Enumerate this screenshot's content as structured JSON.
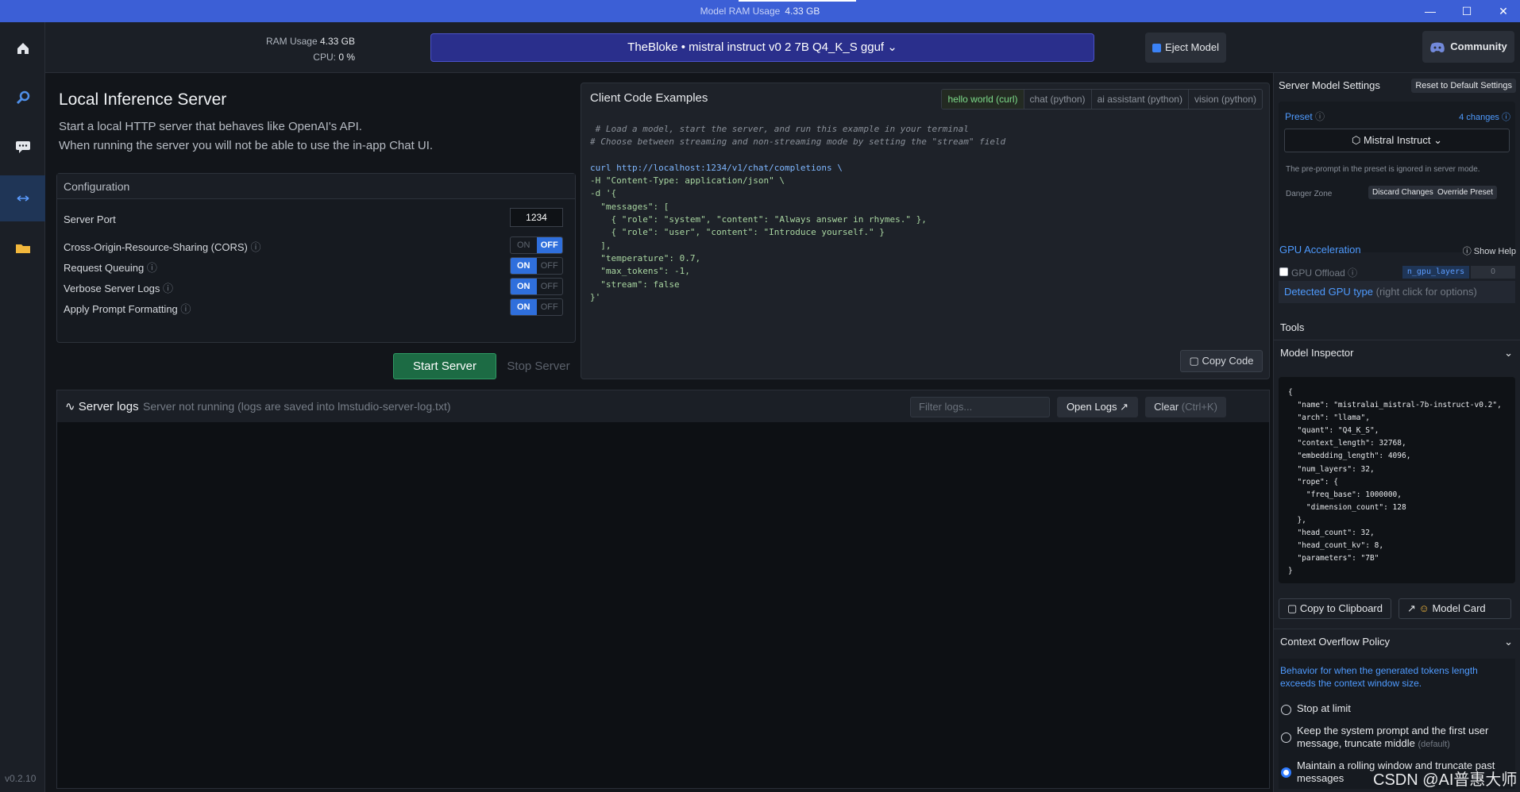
{
  "titlebar": {
    "ram_label": "Model RAM Usage",
    "ram_value": "4.33 GB",
    "minimize": "—",
    "maximize": "☐",
    "close": "✕"
  },
  "sidebar": {
    "version": "v0.2.10",
    "icons": [
      "home-icon",
      "search-icon",
      "chat-icon",
      "server-icon",
      "folder-icon"
    ]
  },
  "topbar": {
    "ram_label": "RAM Usage",
    "ram_value": "4.33 GB",
    "cpu_label": "CPU:",
    "cpu_value": "0 %",
    "model": "TheBloke • mistral instruct v0 2 7B Q4_K_S gguf",
    "eject": "Eject Model",
    "community": "Community"
  },
  "main": {
    "title": "Local Inference Server",
    "desc1": "Start a local HTTP server that behaves like OpenAI's API.",
    "desc2": "When running the server you will not be able to use the in-app Chat UI.",
    "config": {
      "title": "Configuration",
      "port_label": "Server Port",
      "port_value": "1234",
      "rows": [
        {
          "label": "Cross-Origin-Resource-Sharing (CORS)",
          "on": false
        },
        {
          "label": "Request Queuing",
          "on": true
        },
        {
          "label": "Verbose Server Logs",
          "on": true
        },
        {
          "label": "Apply Prompt Formatting",
          "on": true
        }
      ],
      "on_label": "ON",
      "off_label": "OFF",
      "info_glyph": "ⓘ"
    },
    "start": "Start Server",
    "stop": "Stop Server"
  },
  "client": {
    "title": "Client Code Examples",
    "tabs": [
      "hello world (curl)",
      "chat (python)",
      "ai assistant (python)",
      "vision (python)"
    ],
    "code": [
      " # Load a model, start the server, and run this example in your terminal",
      "# Choose between streaming and non-streaming mode by setting the \"stream\" field",
      "",
      "curl http://localhost:1234/v1/chat/completions \\",
      "-H \"Content-Type: application/json\" \\",
      "-d '{",
      "  \"messages\": [",
      "    { \"role\": \"system\", \"content\": \"Always answer in rhymes.\" },",
      "    { \"role\": \"user\", \"content\": \"Introduce yourself.\" }",
      "  ],",
      "  \"temperature\": 0.7,",
      "  \"max_tokens\": -1,",
      "  \"stream\": false",
      "}'"
    ],
    "copy": "Copy Code"
  },
  "logs": {
    "title": "Server logs",
    "status": "Server not running (logs are saved into lmstudio-server-log.txt)",
    "filter_placeholder": "Filter logs...",
    "open": "Open Logs ↗",
    "clear": "Clear",
    "clear_hint": "(Ctrl+K)"
  },
  "right": {
    "title": "Server Model Settings",
    "reset": "Reset to Default Settings",
    "preset_label": "Preset",
    "changes": "4 changes",
    "preset_value": "Mistral Instruct",
    "preset_note": "The pre-prompt in the preset is ignored in server mode.",
    "danger": "Danger Zone",
    "discard": "Discard Changes",
    "override": "Override Preset",
    "gpu_title": "GPU Acceleration",
    "show_help": "Show Help",
    "gpu_offload": "GPU Offload",
    "n_gpu_layers": "n_gpu_layers",
    "n_gpu_value": "0",
    "detected": "Detected GPU type",
    "detected_hint": "(right click for options)",
    "tools": "Tools",
    "inspector": "Model Inspector",
    "inspector_code": [
      "{",
      "  \"name\": \"mistralai_mistral-7b-instruct-v0.2\",",
      "  \"arch\": \"llama\",",
      "  \"quant\": \"Q4_K_S\",",
      "  \"context_length\": 32768,",
      "  \"embedding_length\": 4096,",
      "  \"num_layers\": 32,",
      "  \"rope\": {",
      "    \"freq_base\": 1000000,",
      "    \"dimension_count\": 128",
      "  },",
      "  \"head_count\": 32,",
      "  \"head_count_kv\": 8,",
      "  \"parameters\": \"7B\"",
      "}"
    ],
    "copy_clip": "Copy to Clipboard",
    "model_card": "Model Card",
    "overflow": "Context Overflow Policy",
    "overflow_desc": "Behavior for when the generated tokens length exceeds the context window size.",
    "opt1": "Stop at limit",
    "opt2": "Keep the system prompt and the first user message, truncate middle",
    "opt2_hint": "(default)",
    "opt3": "Maintain a rolling window and truncate past messages"
  },
  "watermark": "CSDN @AI普惠大师",
  "colors": {
    "accent": "#3c5fd6",
    "start": "#1c6b44",
    "toggle_on": "#2f6fdc",
    "link": "#4f9bff"
  }
}
